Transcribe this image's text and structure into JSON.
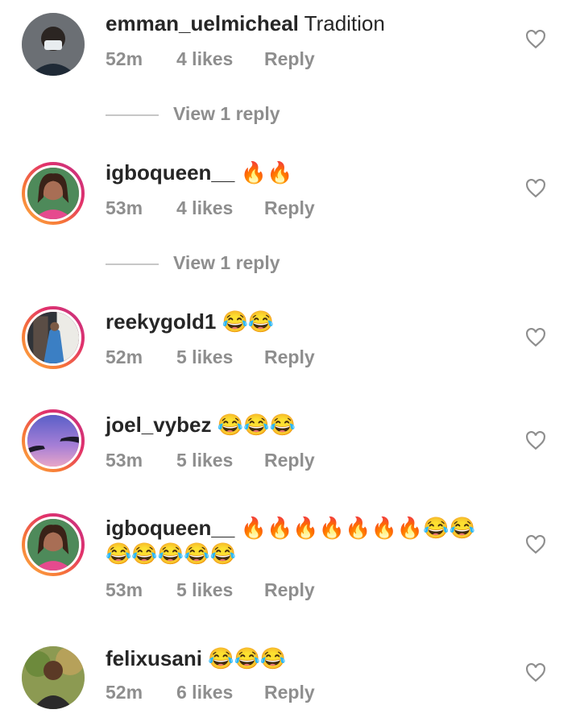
{
  "comments": [
    {
      "username": "emman_uelmicheal",
      "text": "Tradition",
      "time": "52m",
      "likes": "4 likes",
      "reply": "Reply",
      "view_replies": "View 1 reply",
      "avatar": "profile-photo-man-mask"
    },
    {
      "username": "igboqueen__",
      "text": "🔥🔥",
      "time": "53m",
      "likes": "4 likes",
      "reply": "Reply",
      "view_replies": "View 1 reply",
      "avatar": "profile-photo-woman"
    },
    {
      "username": "reekygold1",
      "text": "😂😂",
      "time": "52m",
      "likes": "5 likes",
      "reply": "Reply",
      "avatar": "profile-photo-doorway"
    },
    {
      "username": "joel_vybez",
      "text": "😂😂😂",
      "time": "53m",
      "likes": "5 likes",
      "reply": "Reply",
      "avatar": "profile-photo-hands-sky"
    },
    {
      "username": "igboqueen__",
      "text": "🔥🔥🔥🔥🔥🔥🔥😂😂😂😂😂😂😂",
      "time": "53m",
      "likes": "5 likes",
      "reply": "Reply",
      "avatar": "profile-photo-woman"
    },
    {
      "username": "felixusani",
      "text": "😂😂😂",
      "time": "52m",
      "likes": "6 likes",
      "reply": "Reply",
      "avatar": "profile-photo-man-outdoor"
    }
  ],
  "icons": {
    "like": "heart-outline-icon"
  },
  "colors": {
    "text": "#262626",
    "meta": "#8e8e8e",
    "story_ring_start": "#fcaf45",
    "story_ring_end": "#c13584"
  }
}
